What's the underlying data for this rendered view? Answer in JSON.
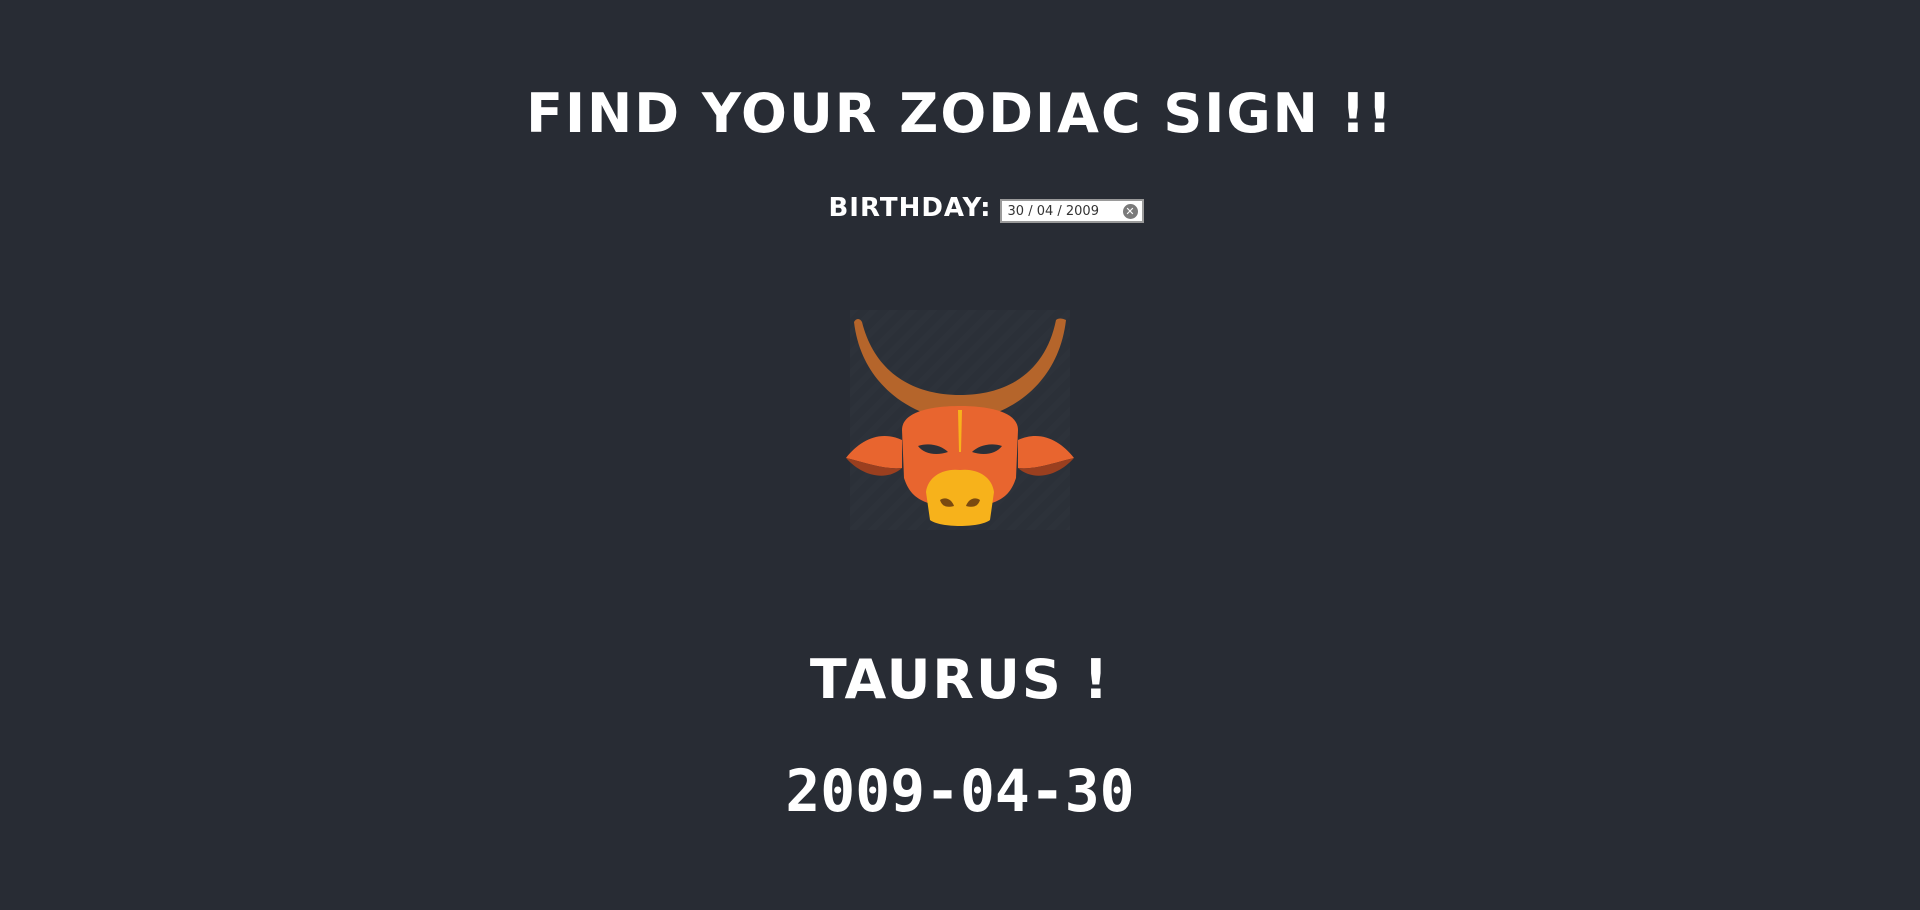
{
  "header": {
    "title": "FIND YOUR ZODIAC SIGN !!"
  },
  "birthday": {
    "label": "BIRTHDAY:",
    "value": "30 / 04 / 2009",
    "clear_icon": "close-icon"
  },
  "result": {
    "image_icon": "taurus-bull-icon",
    "sign": "TAURUS !",
    "date": "2009-04-30"
  },
  "colors": {
    "background": "#282c34",
    "text": "#ffffff",
    "bull_horns": "#b5652b",
    "bull_face": "#e8652f",
    "bull_ears_dark": "#9a3f1f",
    "bull_snout": "#f7b21b"
  }
}
